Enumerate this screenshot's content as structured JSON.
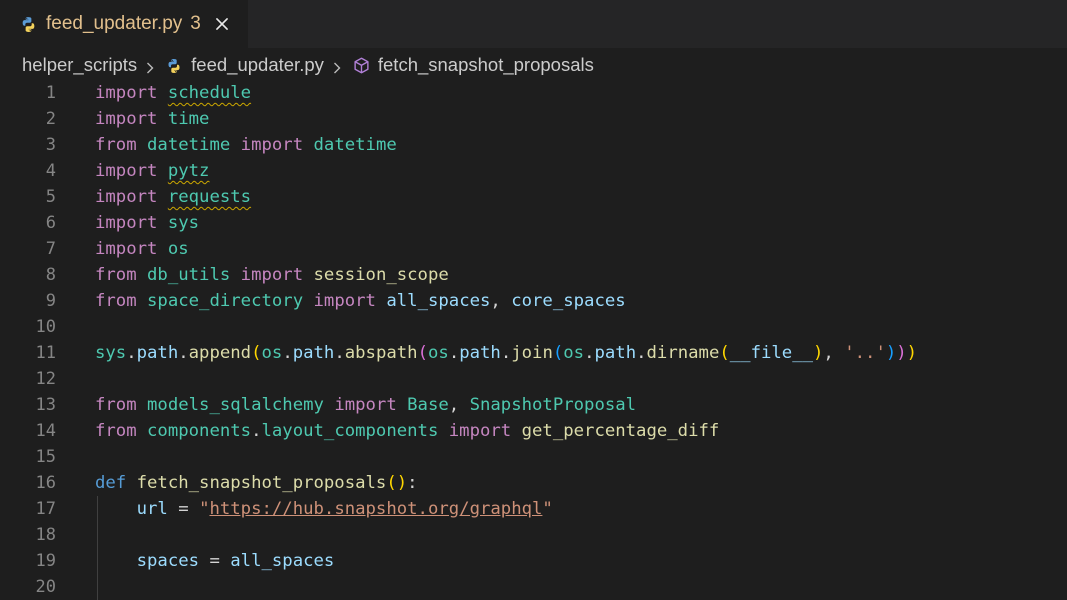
{
  "tab": {
    "name": "feed_updater.py",
    "problems_count": "3"
  },
  "breadcrumb": {
    "folder": "helper_scripts",
    "file": "feed_updater.py",
    "symbol": "fetch_snapshot_proposals"
  },
  "colors": {
    "background": "#1e1e1e",
    "tab_modified": "#e2c08d",
    "keyword_control": "#c586c0",
    "keyword_def": "#569cd6",
    "module": "#4ec9b0",
    "function": "#dcdcaa",
    "variable": "#9cdcfe",
    "string": "#ce9178",
    "warning_squiggle": "#cca700"
  },
  "line_numbers": [
    "1",
    "2",
    "3",
    "4",
    "5",
    "6",
    "7",
    "8",
    "9",
    "10",
    "11",
    "12",
    "13",
    "14",
    "15",
    "16",
    "17",
    "18",
    "19",
    "20"
  ],
  "code": {
    "l1": {
      "kw": "import",
      "mod": "schedule"
    },
    "l2": {
      "kw": "import",
      "mod": "time"
    },
    "l3": {
      "kw1": "from",
      "mod": "datetime",
      "kw2": "import",
      "name": "datetime"
    },
    "l4": {
      "kw": "import",
      "mod": "pytz"
    },
    "l5": {
      "kw": "import",
      "mod": "requests"
    },
    "l6": {
      "kw": "import",
      "mod": "sys"
    },
    "l7": {
      "kw": "import",
      "mod": "os"
    },
    "l8": {
      "kw1": "from",
      "mod": "db_utils",
      "kw2": "import",
      "name": "session_scope"
    },
    "l9": {
      "kw1": "from",
      "mod": "space_directory",
      "kw2": "import",
      "name1": "all_spaces",
      "comma": ",",
      "name2": "core_spaces"
    },
    "l11": {
      "sys": "sys",
      "dot1": ".",
      "path1": "path",
      "dot2": ".",
      "append": "append",
      "p1": "(",
      "os1": "os",
      "dot3": ".",
      "path2": "path",
      "dot4": ".",
      "abspath": "abspath",
      "p2": "(",
      "os2": "os",
      "dot5": ".",
      "path3": "path",
      "dot6": ".",
      "join": "join",
      "p3": "(",
      "os3": "os",
      "dot7": ".",
      "path4": "path",
      "dot8": ".",
      "dirname": "dirname",
      "p4": "(",
      "file": "__file__",
      "p4c": ")",
      "comma": ", ",
      "str": "'..'",
      "p3c": ")",
      "p2c": ")",
      "p1c": ")"
    },
    "l13": {
      "kw1": "from",
      "mod": "models_sqlalchemy",
      "kw2": "import",
      "name1": "Base",
      "comma": ",",
      "name2": "SnapshotProposal"
    },
    "l14": {
      "kw1": "from",
      "mod1": "components",
      "dot": ".",
      "mod2": "layout_components",
      "kw2": "import",
      "name": "get_percentage_diff"
    },
    "l16": {
      "def": "def",
      "fn": "fetch_snapshot_proposals",
      "open": "(",
      "close": ")",
      "colon": ":"
    },
    "l17": {
      "var": "url",
      "eq": " = ",
      "q1": "\"",
      "url": "https://hub.snapshot.org/graphql",
      "q2": "\""
    },
    "l19": {
      "var": "spaces",
      "eq": " = ",
      "val": "all_spaces"
    }
  }
}
